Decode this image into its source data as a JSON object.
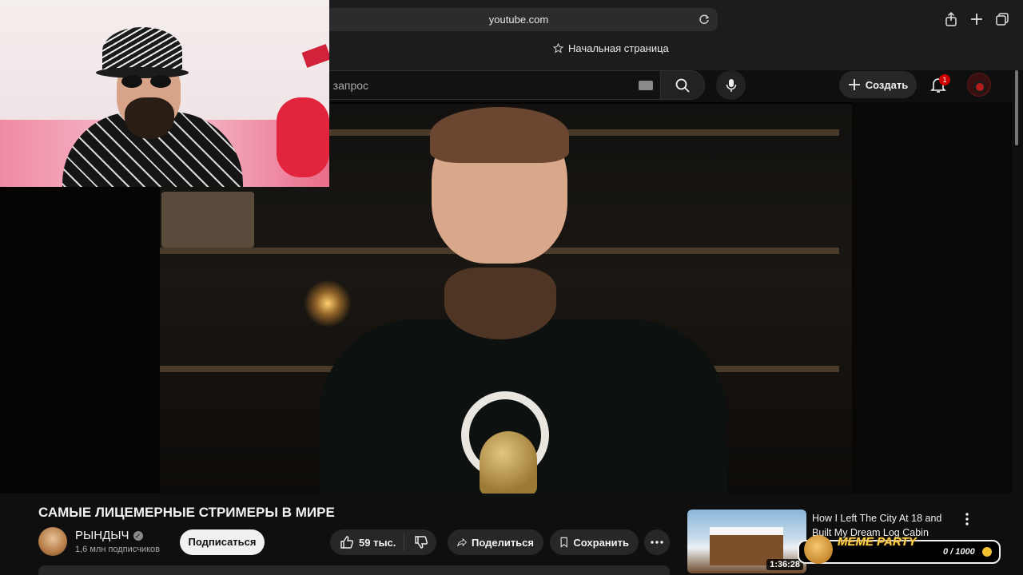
{
  "browser": {
    "url": "youtube.com",
    "bookmark_label": "Начальная страница",
    "icons": [
      "reload-icon",
      "share-icon",
      "plus-icon",
      "tabs-icon",
      "star-icon"
    ]
  },
  "header": {
    "search_placeholder": "е запрос",
    "create_label": "Создать",
    "notification_count": "1",
    "icons": [
      "keyboard-icon",
      "search-icon",
      "mic-icon",
      "plus-icon",
      "bell-icon"
    ]
  },
  "video": {
    "title": "САМЫЕ ЛИЦЕМЕРНЫЕ СТРИМЕРЫ В МИРЕ",
    "channel": "РЫНДЫЧ",
    "subscribers": "1,6 млн подписчиков",
    "subscribe_label": "Подписаться",
    "likes": "59 тыс.",
    "share_label": "Поделиться",
    "save_label": "Сохранить"
  },
  "recommendation": {
    "title": "How I Left The City At 18 and Built My Dream Log Cabin",
    "duration": "1:36:28"
  },
  "overlay": {
    "meme_label": "MEME PARTY",
    "meme_count": "0 / 1000"
  },
  "colors": {
    "background": "#0f0f0f",
    "pill": "#272727",
    "badge": "#cc0000",
    "accent_gold": "#ffd34d"
  }
}
